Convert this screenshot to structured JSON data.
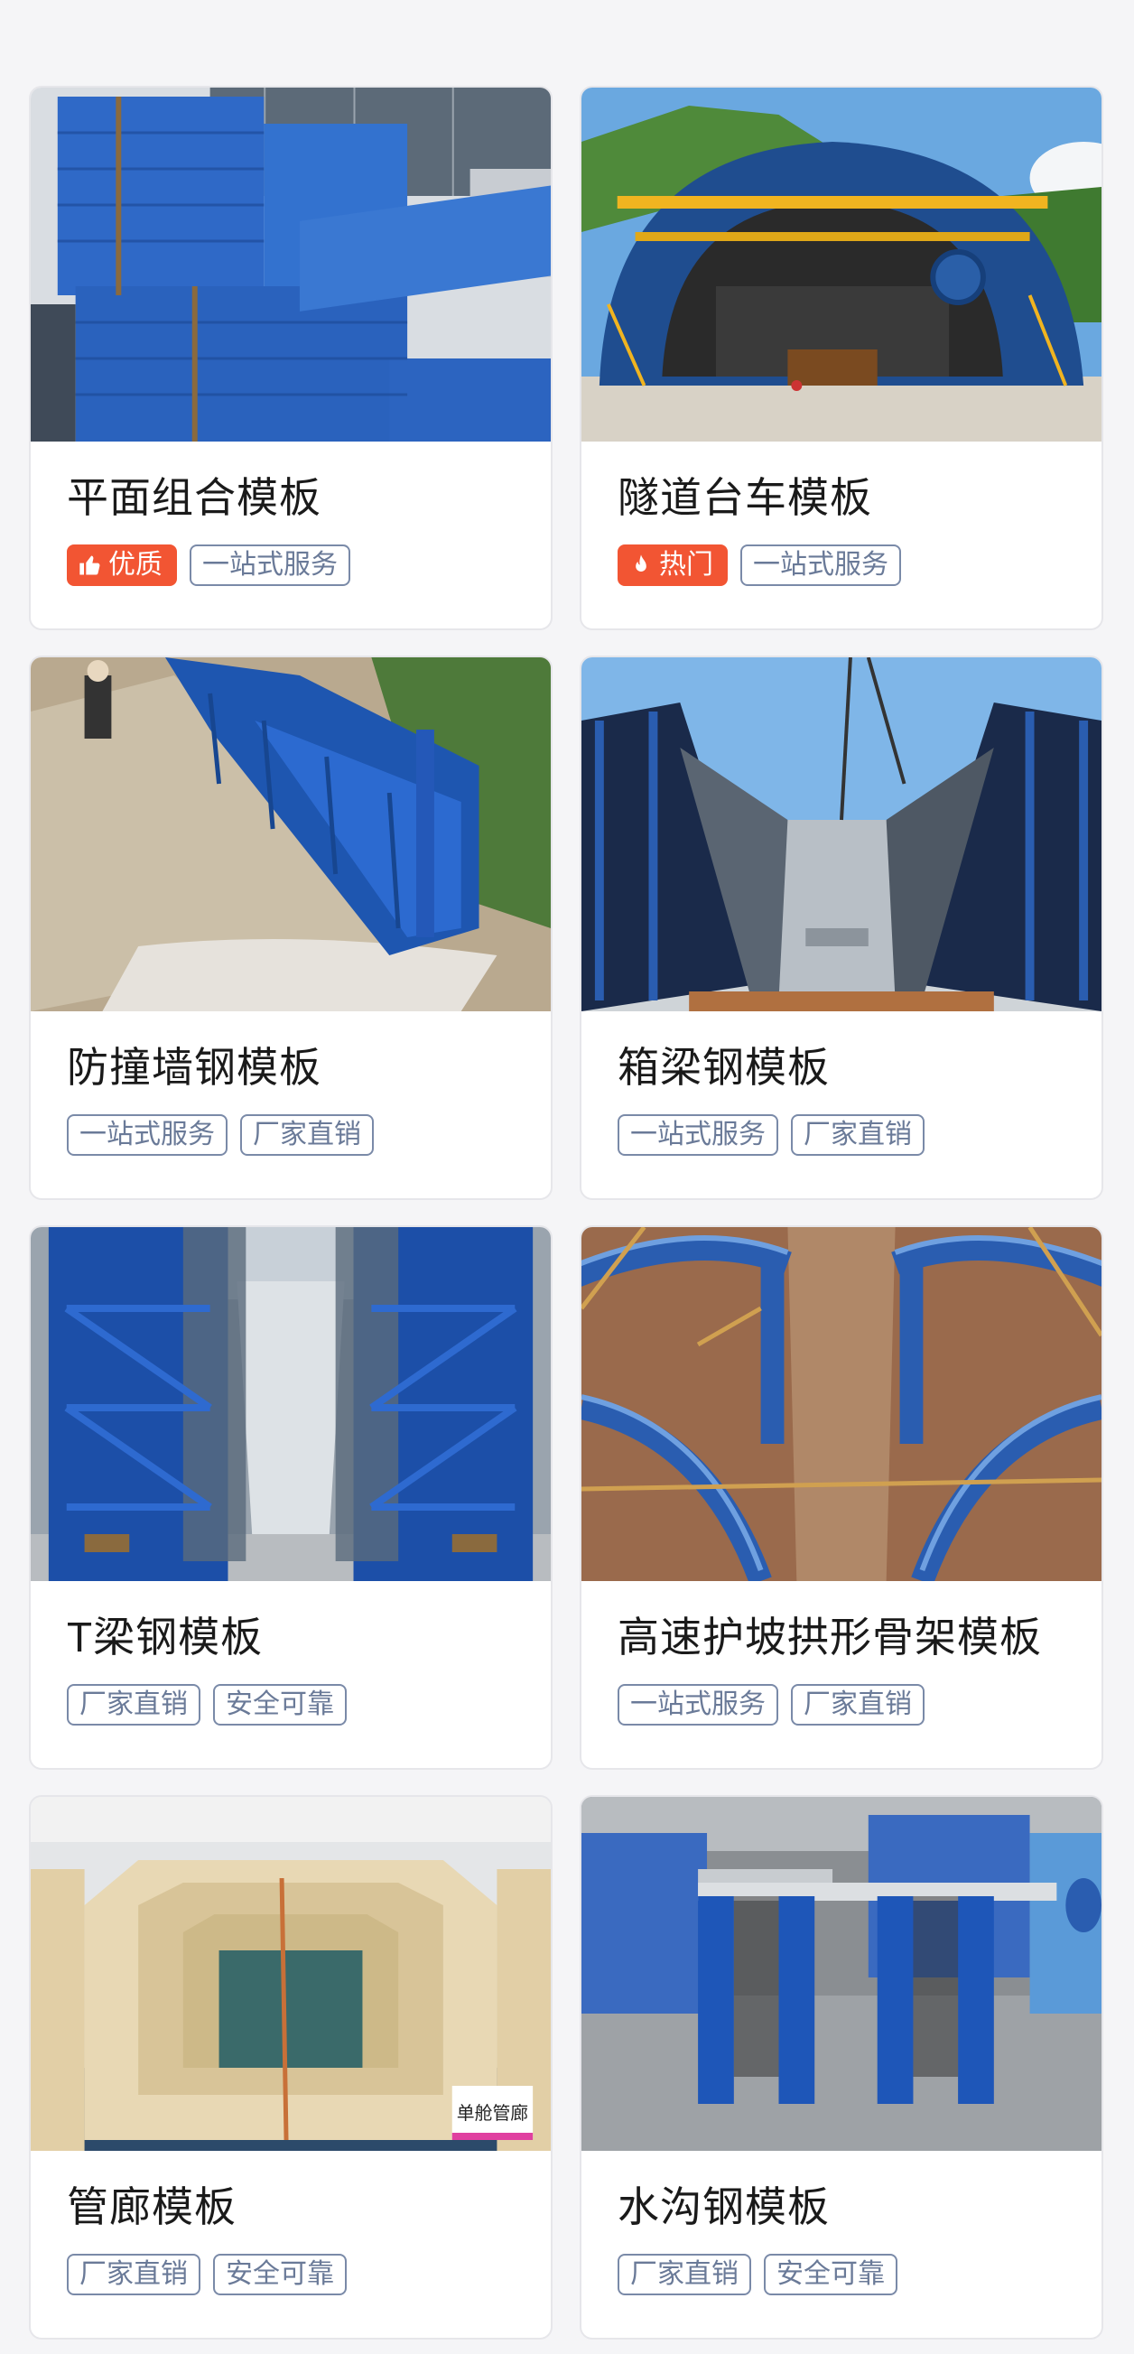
{
  "colors": {
    "accent_tag": "#f25533",
    "tag_border": "#7a8aa8",
    "formwork_blue": "#2a5db0"
  },
  "products": [
    {
      "title": "平面组合模板",
      "tags": [
        {
          "label": "优质",
          "icon": "thumbs-up-icon",
          "highlight": true
        },
        {
          "label": "一站式服务"
        }
      ]
    },
    {
      "title": "隧道台车模板",
      "tags": [
        {
          "label": "热门",
          "icon": "flame-icon",
          "highlight": true
        },
        {
          "label": "一站式服务"
        }
      ]
    },
    {
      "title": "防撞墙钢模板",
      "tags": [
        {
          "label": "一站式服务"
        },
        {
          "label": "厂家直销"
        }
      ]
    },
    {
      "title": "箱梁钢模板",
      "tags": [
        {
          "label": "一站式服务"
        },
        {
          "label": "厂家直销"
        }
      ]
    },
    {
      "title": "T梁钢模板",
      "tags": [
        {
          "label": "厂家直销"
        },
        {
          "label": "安全可靠"
        }
      ]
    },
    {
      "title": "高速护坡拱形骨架模板",
      "tags": [
        {
          "label": "一站式服务"
        },
        {
          "label": "厂家直销"
        }
      ]
    },
    {
      "title": "管廊模板",
      "image_sign": "单舱管廊",
      "tags": [
        {
          "label": "厂家直销"
        },
        {
          "label": "安全可靠"
        }
      ]
    },
    {
      "title": "水沟钢模板",
      "tags": [
        {
          "label": "厂家直销"
        },
        {
          "label": "安全可靠"
        }
      ]
    }
  ]
}
